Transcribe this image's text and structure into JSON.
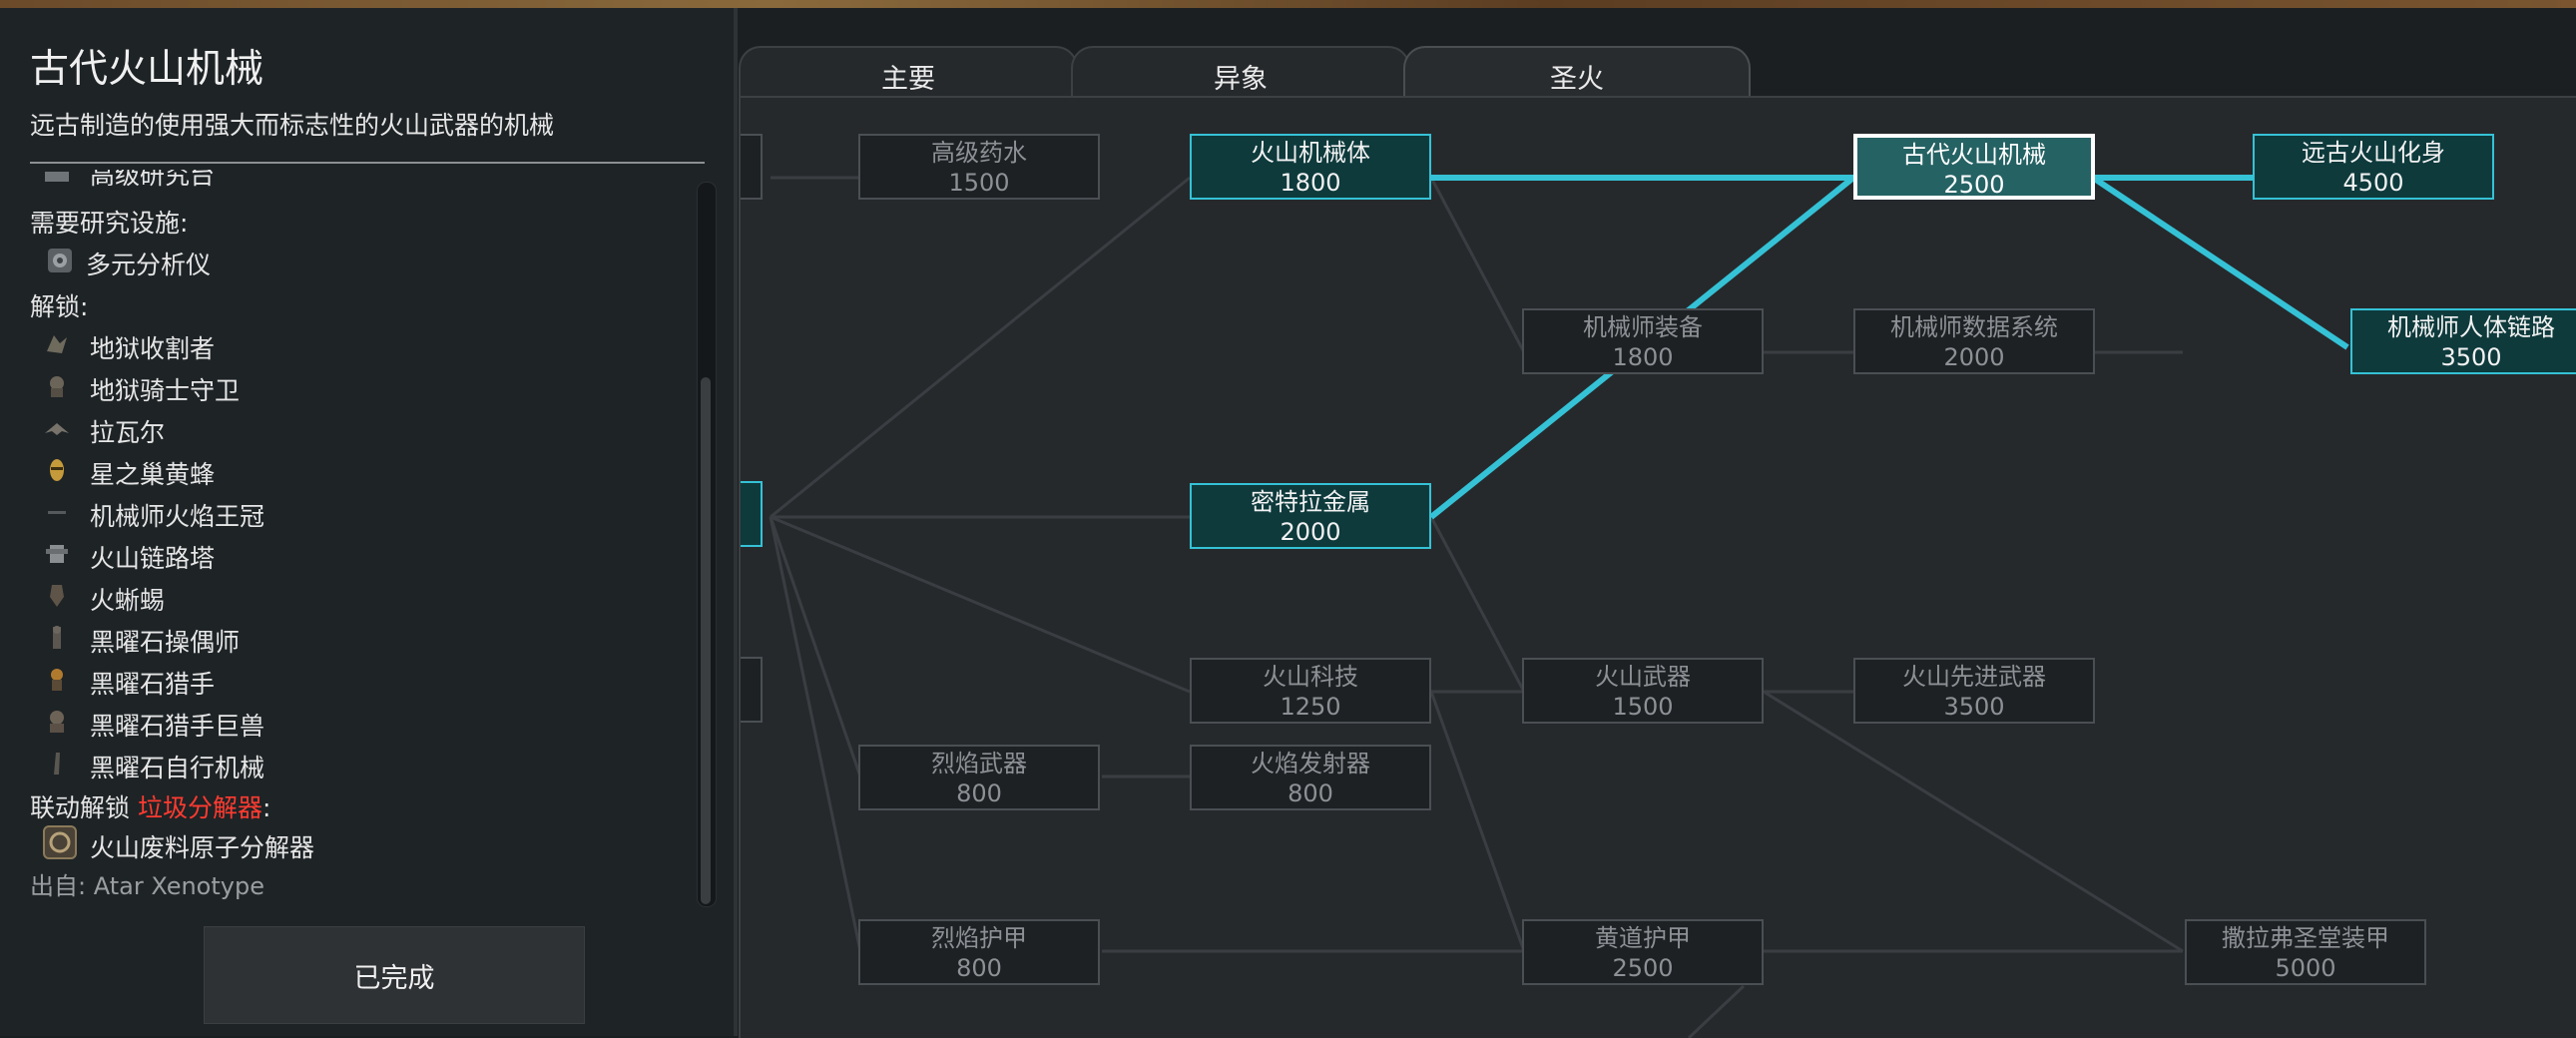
{
  "detail": {
    "title": "古代火山机械",
    "description": "远古制造的使用强大而标志性的火山武器的机械",
    "partial_top_item": "高级研究台",
    "facilities_label": "需要研究设施:",
    "facility_item": "多元分析仪",
    "unlocks_label": "解锁:",
    "unlocks": [
      "地狱收割者",
      "地狱骑士守卫",
      "拉瓦尔",
      "星之巢黄蜂",
      "机械师火焰王冠",
      "火山链路塔",
      "火蜥蜴",
      "黑曜石操偶师",
      "黑曜石猎手",
      "黑曜石猎手巨兽",
      "黑曜石自行机械"
    ],
    "linked_prefix": "联动解锁",
    "linked_name": "垃圾分解器",
    "linked_suffix": ":",
    "linked_item": "火山废料原子分解器",
    "source_label": "出自:",
    "source_value": "Atar Xenotype",
    "done_button": "已完成"
  },
  "tabs": [
    {
      "label": "主要",
      "active": false
    },
    {
      "label": "异象",
      "active": false
    },
    {
      "label": "圣火",
      "active": true
    }
  ],
  "tree": {
    "accent_color": "#35c2d6",
    "nodes": [
      {
        "id": "adv_potion",
        "name": "高级药水",
        "cost": "1500",
        "state": "locked"
      },
      {
        "id": "volc_mech_body",
        "name": "火山机械体",
        "cost": "1800",
        "state": "done"
      },
      {
        "id": "ancient_volc_mech",
        "name": "古代火山机械",
        "cost": "2500",
        "state": "selected"
      },
      {
        "id": "ancient_avatar",
        "name": "远古火山化身",
        "cost": "4500",
        "state": "done"
      },
      {
        "id": "mech_equip",
        "name": "机械师装备",
        "cost": "1800",
        "state": "locked"
      },
      {
        "id": "mech_data",
        "name": "机械师数据系统",
        "cost": "2000",
        "state": "locked"
      },
      {
        "id": "mech_link",
        "name": "机械师人体链路",
        "cost": "3500",
        "state": "done"
      },
      {
        "id": "mithril",
        "name": "密特拉金属",
        "cost": "2000",
        "state": "done"
      },
      {
        "id": "volc_tech",
        "name": "火山科技",
        "cost": "1250",
        "state": "locked"
      },
      {
        "id": "volc_weapon",
        "name": "火山武器",
        "cost": "1500",
        "state": "locked"
      },
      {
        "id": "volc_adv_weapon",
        "name": "火山先进武器",
        "cost": "3500",
        "state": "locked"
      },
      {
        "id": "flame_weapon",
        "name": "烈焰武器",
        "cost": "800",
        "state": "locked"
      },
      {
        "id": "flame_launcher",
        "name": "火焰发射器",
        "cost": "800",
        "state": "locked"
      },
      {
        "id": "flame_armor",
        "name": "烈焰护甲",
        "cost": "800",
        "state": "locked"
      },
      {
        "id": "zodiac_armor",
        "name": "黄道护甲",
        "cost": "2500",
        "state": "locked"
      },
      {
        "id": "salafu_armor",
        "name": "撒拉弗圣堂装甲",
        "cost": "5000",
        "state": "locked"
      }
    ]
  }
}
